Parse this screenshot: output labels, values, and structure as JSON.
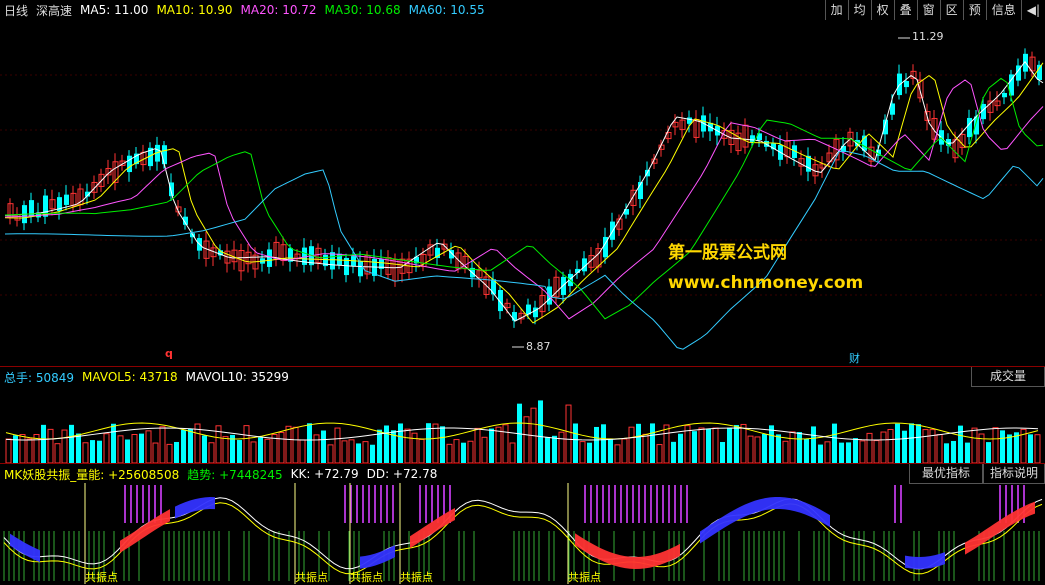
{
  "price_panel": {
    "period": "日线",
    "stock_name": "深高速",
    "ma": [
      {
        "label": "MA5: 11.00",
        "color": "#ffffff"
      },
      {
        "label": "MA10: 10.90",
        "color": "#ffff00"
      },
      {
        "label": "MA20: 10.72",
        "color": "#ff55ff"
      },
      {
        "label": "MA30: 10.68",
        "color": "#00ee00"
      },
      {
        "label": "MA60: 10.55",
        "color": "#33ccff"
      }
    ],
    "high_label": "11.29",
    "low_label": "8.87",
    "marker_q": "q",
    "marker_cai": "财"
  },
  "toolbar": [
    "加",
    "均",
    "权",
    "叠",
    "窗",
    "区",
    "预",
    "信息",
    "◀|"
  ],
  "watermark": {
    "title": "第一股票公式网",
    "url": "www.chnmoney.com"
  },
  "volume_panel": {
    "items": [
      {
        "label": "总手: 50849",
        "color": "#33ccff"
      },
      {
        "label": "MAVOL5: 43718",
        "color": "#ffff00"
      },
      {
        "label": "MAVOL10: 35299",
        "color": "#ffffff"
      }
    ],
    "button": "成交量"
  },
  "indicator_panel": {
    "items": [
      {
        "label": "MK妖股共振_量能: +25608508",
        "color": "#ffff00"
      },
      {
        "label": "趋势: +7448245",
        "color": "#00ee00"
      },
      {
        "label": "KK: +72.79",
        "color": "#ffffff"
      },
      {
        "label": "DD: +72.78",
        "color": "#ffffff"
      }
    ],
    "buttons": [
      "最优指标",
      "指标说明"
    ],
    "resonance_label": "共振点"
  },
  "chart_data": {
    "type": "candlestick",
    "price_range": [
      8.6,
      11.5
    ],
    "ma_periods": [
      5,
      10,
      20,
      30,
      60
    ]
  }
}
